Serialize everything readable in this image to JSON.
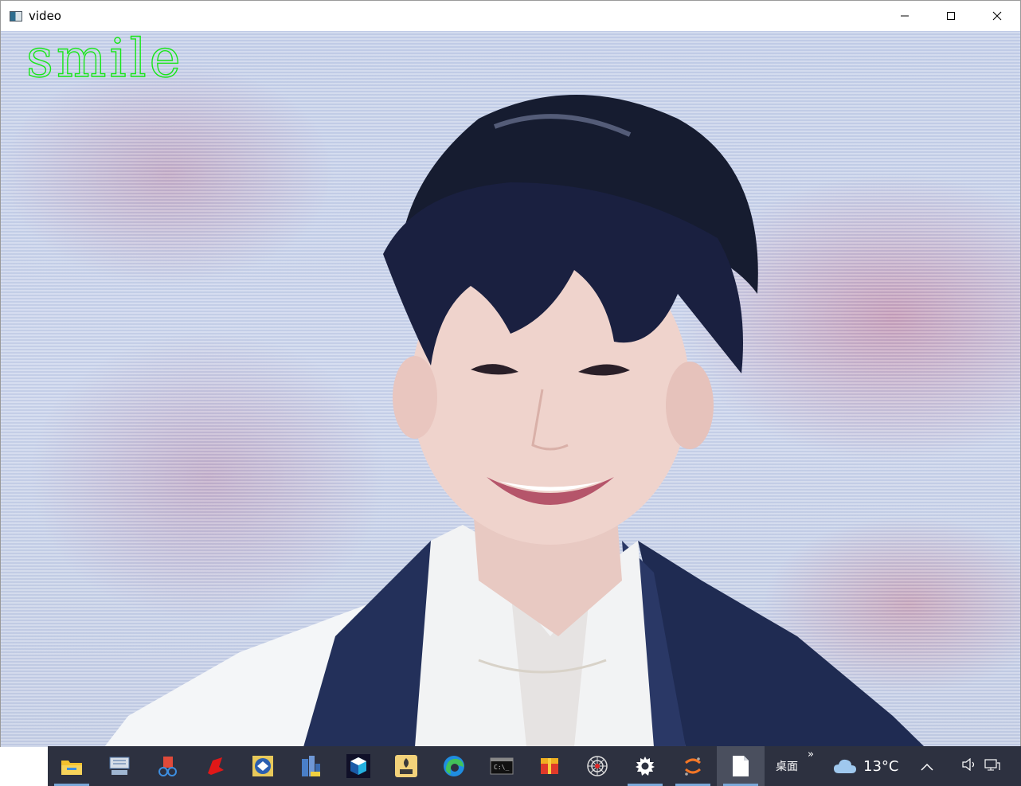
{
  "window": {
    "title": "video"
  },
  "video": {
    "caption": "smile",
    "caption_color": "#19e619"
  },
  "taskbar": {
    "pinned_icons": [
      {
        "name": "file-explorer-icon"
      },
      {
        "name": "keyboard-app-icon"
      },
      {
        "name": "snipping-tool-icon"
      },
      {
        "name": "red-app-icon"
      },
      {
        "name": "blue-app-icon"
      },
      {
        "name": "city-app-icon"
      },
      {
        "name": "cube-app-icon"
      },
      {
        "name": "yehuo-app-icon"
      },
      {
        "name": "edge-icon"
      },
      {
        "name": "terminal-icon"
      },
      {
        "name": "box-app-icon"
      },
      {
        "name": "spider-web-icon"
      },
      {
        "name": "settings-icon"
      },
      {
        "name": "jupyter-icon"
      },
      {
        "name": "document-icon"
      }
    ],
    "desktop_label": "桌面",
    "desktop_chevron": "»",
    "weather_temp": "13°C"
  },
  "colors": {
    "taskbar_bg": "#2d3140",
    "active_indicator": "#7aa8d8"
  }
}
